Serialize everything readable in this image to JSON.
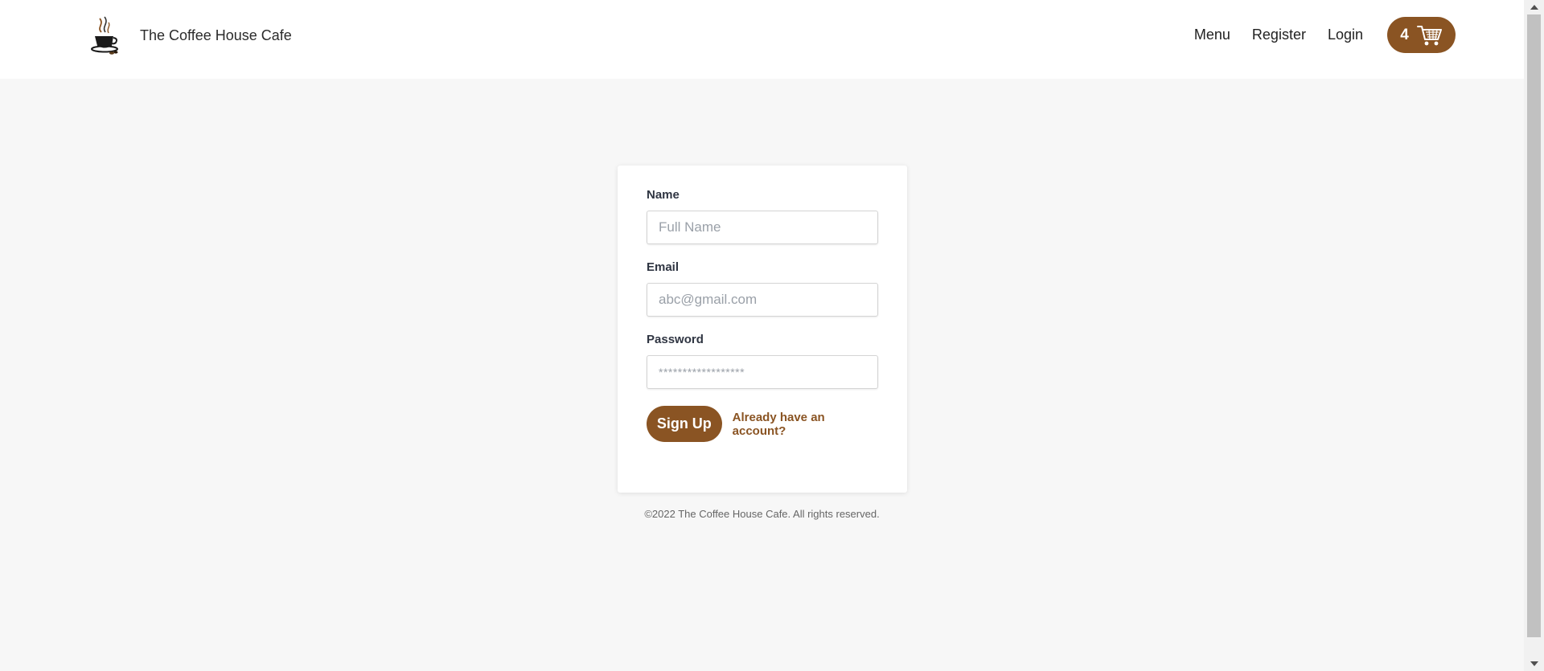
{
  "header": {
    "brand_name": "The Coffee House Cafe",
    "logo_icon": "coffee-cup-icon",
    "nav": [
      {
        "label": "Menu"
      },
      {
        "label": "Register"
      },
      {
        "label": "Login"
      }
    ],
    "cart": {
      "count": "4",
      "icon": "shopping-cart-icon"
    }
  },
  "form": {
    "name": {
      "label": "Name",
      "placeholder": "Full Name",
      "value": ""
    },
    "email": {
      "label": "Email",
      "placeholder": "abc@gmail.com",
      "value": ""
    },
    "password": {
      "label": "Password",
      "placeholder": "******************",
      "value": ""
    },
    "submit_label": "Sign Up",
    "login_link": "Already have an account?"
  },
  "footer": {
    "text": "©2022 The Coffee House Cafe. All rights reserved."
  },
  "colors": {
    "accent": "#8a5423",
    "background": "#f7f7f7",
    "card": "#ffffff"
  }
}
